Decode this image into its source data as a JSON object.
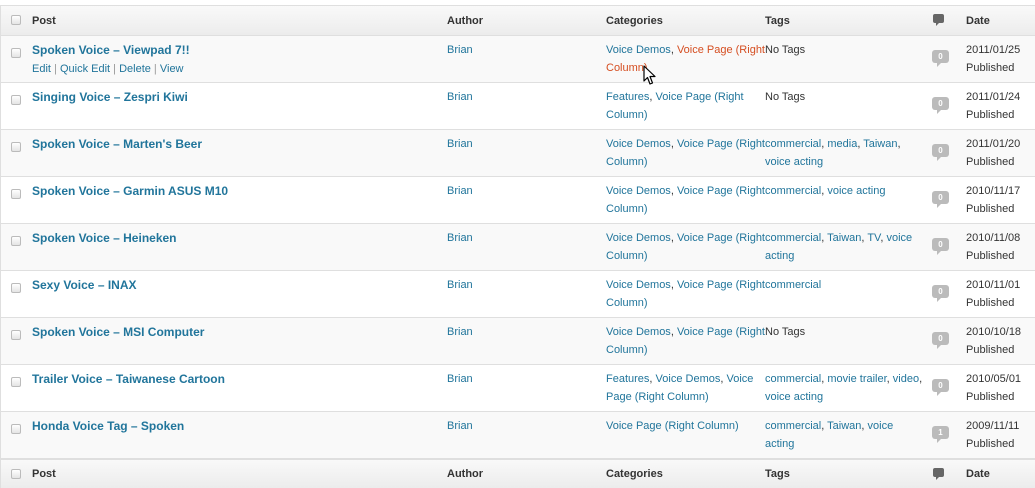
{
  "columns": {
    "post": "Post",
    "author": "Author",
    "categories": "Categories",
    "tags": "Tags",
    "date": "Date"
  },
  "row_actions": {
    "edit": "Edit",
    "quick_edit": "Quick Edit",
    "delete": "Delete",
    "view": "View",
    "separator": " | "
  },
  "posts": [
    {
      "title": "Spoken Voice – Viewpad 7!!",
      "author": "Brian",
      "categories": [
        "Voice Demos",
        "Voice Page (Right Column)"
      ],
      "tags": [],
      "tags_none": "No Tags",
      "comments": "0",
      "date": "2011/01/25",
      "status": "Published"
    },
    {
      "title": "Singing Voice – Zespri Kiwi",
      "author": "Brian",
      "categories": [
        "Features",
        "Voice Page (Right Column)"
      ],
      "tags": [],
      "tags_none": "No Tags",
      "comments": "0",
      "date": "2011/01/24",
      "status": "Published"
    },
    {
      "title": "Spoken Voice – Marten's Beer",
      "author": "Brian",
      "categories": [
        "Voice Demos",
        "Voice Page (Right Column)"
      ],
      "tags": [
        "commercial",
        "media",
        "Taiwan",
        "voice acting"
      ],
      "comments": "0",
      "date": "2011/01/20",
      "status": "Published"
    },
    {
      "title": "Spoken Voice – Garmin ASUS M10",
      "author": "Brian",
      "categories": [
        "Voice Demos",
        "Voice Page (Right Column)"
      ],
      "tags": [
        "commercial",
        "voice acting"
      ],
      "comments": "0",
      "date": "2010/11/17",
      "status": "Published"
    },
    {
      "title": "Spoken Voice – Heineken",
      "author": "Brian",
      "categories": [
        "Voice Demos",
        "Voice Page (Right Column)"
      ],
      "tags": [
        "commercial",
        "Taiwan",
        "TV",
        "voice acting"
      ],
      "comments": "0",
      "date": "2010/11/08",
      "status": "Published"
    },
    {
      "title": "Sexy Voice – INAX",
      "author": "Brian",
      "categories": [
        "Voice Demos",
        "Voice Page (Right Column)"
      ],
      "tags": [
        "commercial"
      ],
      "comments": "0",
      "date": "2010/11/01",
      "status": "Published"
    },
    {
      "title": "Spoken Voice – MSI Computer",
      "author": "Brian",
      "categories": [
        "Voice Demos",
        "Voice Page (Right Column)"
      ],
      "tags": [],
      "tags_none": "No Tags",
      "comments": "0",
      "date": "2010/10/18",
      "status": "Published"
    },
    {
      "title": "Trailer Voice – Taiwanese Cartoon",
      "author": "Brian",
      "categories": [
        "Features",
        "Voice Demos",
        "Voice Page (Right Column)"
      ],
      "tags": [
        "commercial",
        "movie trailer",
        "video",
        "voice acting"
      ],
      "comments": "0",
      "date": "2010/05/01",
      "status": "Published"
    },
    {
      "title": "Honda Voice Tag – Spoken",
      "author": "Brian",
      "categories": [
        "Voice Page (Right Column)"
      ],
      "tags": [
        "commercial",
        "Taiwan",
        "voice acting"
      ],
      "comments": "1",
      "date": "2009/11/11",
      "status": "Published"
    }
  ],
  "colors": {
    "link": "#21759b",
    "link_hover": "#d54e21",
    "row_alt": "#f9f9f9",
    "border": "#dfdfdf"
  },
  "icons": {
    "comments_header": "comment-bubble-icon",
    "cursor": "mouse-pointer-icon"
  }
}
